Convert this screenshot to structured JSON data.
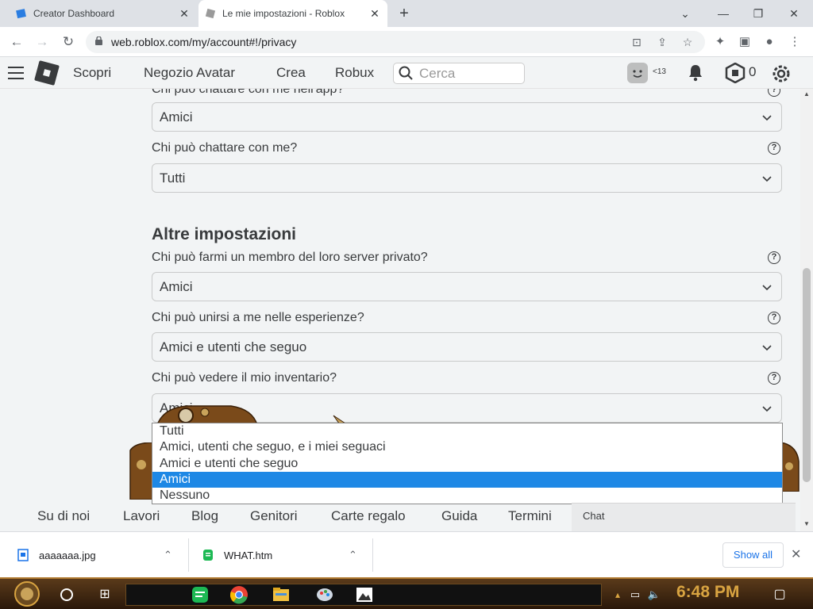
{
  "browser": {
    "tabs": [
      {
        "title": "Creator Dashboard",
        "active": false
      },
      {
        "title": "Le mie impostazioni - Roblox",
        "active": true
      }
    ],
    "new_tab": "+",
    "url": "web.roblox.com/my/account#!/privacy",
    "window_controls": [
      "minimize",
      "restore",
      "close"
    ]
  },
  "header": {
    "nav": [
      "Scopri",
      "Negozio Avatar",
      "Crea",
      "Robux"
    ],
    "search_placeholder": "Cerca",
    "age_badge": "<13",
    "robux_count": "0"
  },
  "privacy": {
    "partial_label": "Chi può chattare con me nell'app?",
    "chat_app_value": "Amici",
    "chat_label": "Chi può chattare con me?",
    "chat_value": "Tutti",
    "section_title": "Altre impostazioni",
    "server_label": "Chi può farmi un membro del loro server privato?",
    "server_value": "Amici",
    "join_label": "Chi può unirsi a me nelle esperienze?",
    "join_value": "Amici e utenti che seguo",
    "inventory_label": "Chi può vedere il mio inventario?",
    "inventory_value": "Amici",
    "inventory_options": [
      "Tutti",
      "Amici, utenti che seguo, e i miei seguaci",
      "Amici e utenti che seguo",
      "Amici",
      "Nessuno"
    ],
    "selected_option_index": 3
  },
  "footer": {
    "links": [
      "Su di noi",
      "Lavori",
      "Blog",
      "Genitori",
      "Carte regalo",
      "Guida",
      "Termini"
    ],
    "chat": "Chat"
  },
  "downloads": {
    "items": [
      "aaaaaaa.jpg",
      "WHAT.htm"
    ],
    "show_all": "Show all"
  },
  "taskbar": {
    "clock": "6:48 PM"
  }
}
